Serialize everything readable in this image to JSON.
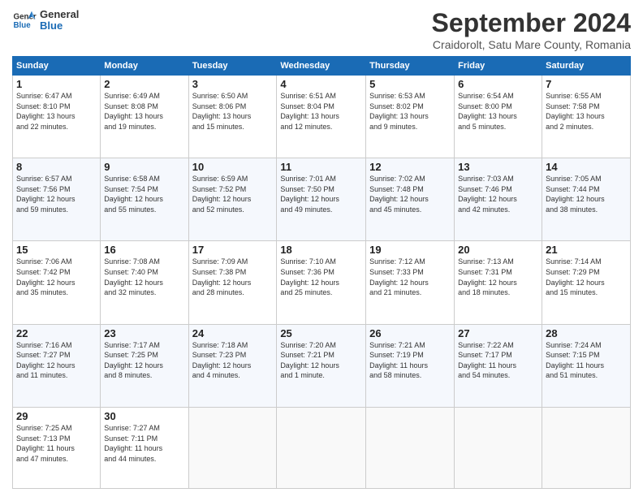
{
  "header": {
    "logo_line1": "General",
    "logo_line2": "Blue",
    "month": "September 2024",
    "location": "Craidorolt, Satu Mare County, Romania"
  },
  "days_of_week": [
    "Sunday",
    "Monday",
    "Tuesday",
    "Wednesday",
    "Thursday",
    "Friday",
    "Saturday"
  ],
  "weeks": [
    [
      {
        "day": "1",
        "info": "Sunrise: 6:47 AM\nSunset: 8:10 PM\nDaylight: 13 hours\nand 22 minutes."
      },
      {
        "day": "2",
        "info": "Sunrise: 6:49 AM\nSunset: 8:08 PM\nDaylight: 13 hours\nand 19 minutes."
      },
      {
        "day": "3",
        "info": "Sunrise: 6:50 AM\nSunset: 8:06 PM\nDaylight: 13 hours\nand 15 minutes."
      },
      {
        "day": "4",
        "info": "Sunrise: 6:51 AM\nSunset: 8:04 PM\nDaylight: 13 hours\nand 12 minutes."
      },
      {
        "day": "5",
        "info": "Sunrise: 6:53 AM\nSunset: 8:02 PM\nDaylight: 13 hours\nand 9 minutes."
      },
      {
        "day": "6",
        "info": "Sunrise: 6:54 AM\nSunset: 8:00 PM\nDaylight: 13 hours\nand 5 minutes."
      },
      {
        "day": "7",
        "info": "Sunrise: 6:55 AM\nSunset: 7:58 PM\nDaylight: 13 hours\nand 2 minutes."
      }
    ],
    [
      {
        "day": "8",
        "info": "Sunrise: 6:57 AM\nSunset: 7:56 PM\nDaylight: 12 hours\nand 59 minutes."
      },
      {
        "day": "9",
        "info": "Sunrise: 6:58 AM\nSunset: 7:54 PM\nDaylight: 12 hours\nand 55 minutes."
      },
      {
        "day": "10",
        "info": "Sunrise: 6:59 AM\nSunset: 7:52 PM\nDaylight: 12 hours\nand 52 minutes."
      },
      {
        "day": "11",
        "info": "Sunrise: 7:01 AM\nSunset: 7:50 PM\nDaylight: 12 hours\nand 49 minutes."
      },
      {
        "day": "12",
        "info": "Sunrise: 7:02 AM\nSunset: 7:48 PM\nDaylight: 12 hours\nand 45 minutes."
      },
      {
        "day": "13",
        "info": "Sunrise: 7:03 AM\nSunset: 7:46 PM\nDaylight: 12 hours\nand 42 minutes."
      },
      {
        "day": "14",
        "info": "Sunrise: 7:05 AM\nSunset: 7:44 PM\nDaylight: 12 hours\nand 38 minutes."
      }
    ],
    [
      {
        "day": "15",
        "info": "Sunrise: 7:06 AM\nSunset: 7:42 PM\nDaylight: 12 hours\nand 35 minutes."
      },
      {
        "day": "16",
        "info": "Sunrise: 7:08 AM\nSunset: 7:40 PM\nDaylight: 12 hours\nand 32 minutes."
      },
      {
        "day": "17",
        "info": "Sunrise: 7:09 AM\nSunset: 7:38 PM\nDaylight: 12 hours\nand 28 minutes."
      },
      {
        "day": "18",
        "info": "Sunrise: 7:10 AM\nSunset: 7:36 PM\nDaylight: 12 hours\nand 25 minutes."
      },
      {
        "day": "19",
        "info": "Sunrise: 7:12 AM\nSunset: 7:33 PM\nDaylight: 12 hours\nand 21 minutes."
      },
      {
        "day": "20",
        "info": "Sunrise: 7:13 AM\nSunset: 7:31 PM\nDaylight: 12 hours\nand 18 minutes."
      },
      {
        "day": "21",
        "info": "Sunrise: 7:14 AM\nSunset: 7:29 PM\nDaylight: 12 hours\nand 15 minutes."
      }
    ],
    [
      {
        "day": "22",
        "info": "Sunrise: 7:16 AM\nSunset: 7:27 PM\nDaylight: 12 hours\nand 11 minutes."
      },
      {
        "day": "23",
        "info": "Sunrise: 7:17 AM\nSunset: 7:25 PM\nDaylight: 12 hours\nand 8 minutes."
      },
      {
        "day": "24",
        "info": "Sunrise: 7:18 AM\nSunset: 7:23 PM\nDaylight: 12 hours\nand 4 minutes."
      },
      {
        "day": "25",
        "info": "Sunrise: 7:20 AM\nSunset: 7:21 PM\nDaylight: 12 hours\nand 1 minute."
      },
      {
        "day": "26",
        "info": "Sunrise: 7:21 AM\nSunset: 7:19 PM\nDaylight: 11 hours\nand 58 minutes."
      },
      {
        "day": "27",
        "info": "Sunrise: 7:22 AM\nSunset: 7:17 PM\nDaylight: 11 hours\nand 54 minutes."
      },
      {
        "day": "28",
        "info": "Sunrise: 7:24 AM\nSunset: 7:15 PM\nDaylight: 11 hours\nand 51 minutes."
      }
    ],
    [
      {
        "day": "29",
        "info": "Sunrise: 7:25 AM\nSunset: 7:13 PM\nDaylight: 11 hours\nand 47 minutes."
      },
      {
        "day": "30",
        "info": "Sunrise: 7:27 AM\nSunset: 7:11 PM\nDaylight: 11 hours\nand 44 minutes."
      },
      {
        "day": "",
        "info": ""
      },
      {
        "day": "",
        "info": ""
      },
      {
        "day": "",
        "info": ""
      },
      {
        "day": "",
        "info": ""
      },
      {
        "day": "",
        "info": ""
      }
    ]
  ]
}
